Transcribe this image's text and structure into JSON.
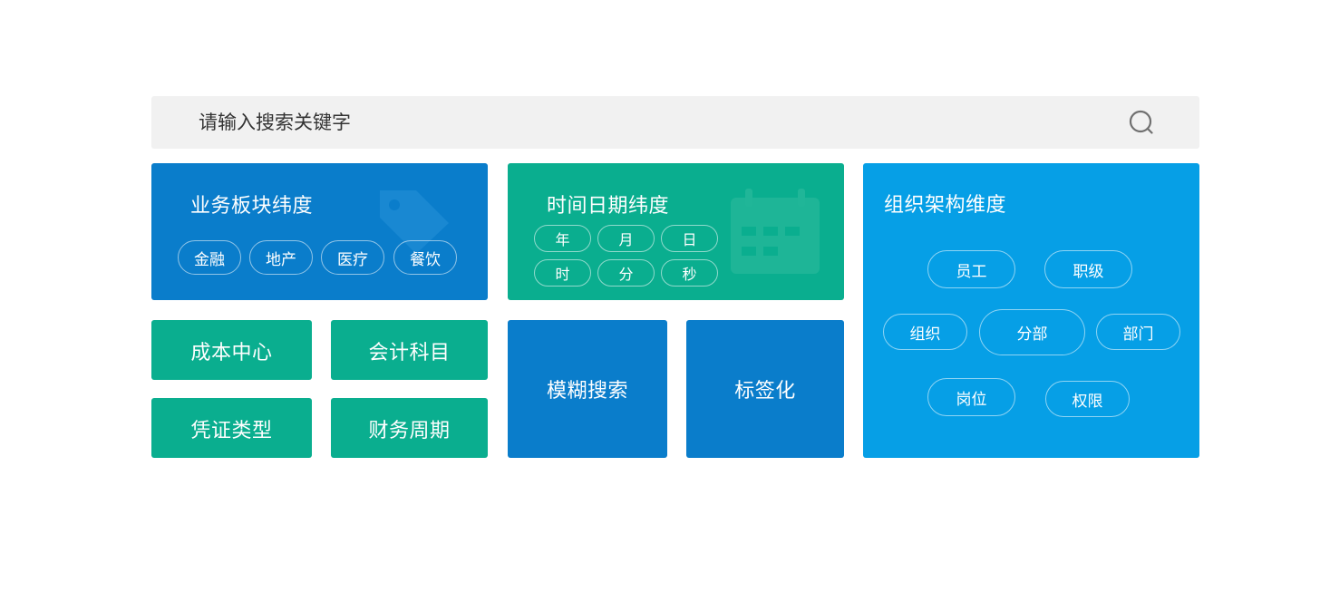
{
  "search": {
    "placeholder": "请输入搜索关键字",
    "icon": "search-icon"
  },
  "colors": {
    "dark_blue": "#0a7dcb",
    "green": "#0aae8f",
    "light_blue": "#069fe6",
    "search_bg": "#f1f1f1"
  },
  "business": {
    "title": "业务板块纬度",
    "icon": "tag-icon",
    "tags": [
      "金融",
      "地产",
      "医疗",
      "餐饮"
    ]
  },
  "datetime": {
    "title": "时间日期纬度",
    "icon": "calendar-icon",
    "tags": [
      "年",
      "月",
      "日",
      "时",
      "分",
      "秒"
    ]
  },
  "org": {
    "title": "组织架构维度",
    "tags": [
      "员工",
      "职级",
      "组织",
      "分部",
      "部门",
      "岗位",
      "权限"
    ]
  },
  "finance": {
    "items": [
      "成本中心",
      "会计科目",
      "凭证类型",
      "财务周期"
    ]
  },
  "features": {
    "fuzzy_search": "模糊搜索",
    "tagging": "标签化"
  }
}
